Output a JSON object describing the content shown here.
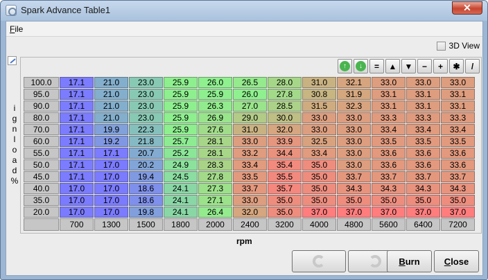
{
  "window": {
    "title": "Spark Advance Table1"
  },
  "menu": {
    "file_rest": "ile",
    "file_mnemonic": "F"
  },
  "view3d": {
    "label": "3D View",
    "checked": false
  },
  "toolbar": {
    "icons": [
      "up-circle-icon",
      "down-circle-icon",
      "equals-icon",
      "increase-icon",
      "decrease-icon",
      "minus-icon",
      "plus-icon",
      "multiply-icon",
      "color-scale-icon"
    ],
    "labels": [
      "↑",
      "↓",
      "=",
      "▲",
      "▼",
      "−",
      "+",
      "✱",
      "/"
    ]
  },
  "axis": {
    "y_label": "ignload%",
    "x_label": "rpm"
  },
  "table": {
    "rows": [
      "100.0",
      "95.0",
      "90.0",
      "80.0",
      "70.0",
      "60.0",
      "55.0",
      "50.0",
      "45.0",
      "40.0",
      "35.0",
      "20.0"
    ],
    "columns": [
      "700",
      "1300",
      "1500",
      "1800",
      "2000",
      "2400",
      "3200",
      "4000",
      "4800",
      "5600",
      "6400",
      "7200"
    ],
    "values": [
      [
        "17.1",
        "21.0",
        "23.0",
        "25.9",
        "26.0",
        "26.5",
        "28.0",
        "31.0",
        "32.1",
        "33.0",
        "33.0",
        "33.0"
      ],
      [
        "17.1",
        "21.0",
        "23.0",
        "25.9",
        "25.9",
        "26.0",
        "27.8",
        "30.8",
        "31.9",
        "33.1",
        "33.1",
        "33.1"
      ],
      [
        "17.1",
        "21.0",
        "23.0",
        "25.9",
        "26.3",
        "27.0",
        "28.5",
        "31.5",
        "32.3",
        "33.1",
        "33.1",
        "33.1"
      ],
      [
        "17.1",
        "21.0",
        "23.0",
        "25.9",
        "26.9",
        "29.0",
        "30.0",
        "33.0",
        "33.0",
        "33.3",
        "33.3",
        "33.3"
      ],
      [
        "17.1",
        "19.9",
        "22.3",
        "25.9",
        "27.6",
        "31.0",
        "32.0",
        "33.0",
        "33.0",
        "33.4",
        "33.4",
        "33.4"
      ],
      [
        "17.1",
        "19.2",
        "21.8",
        "25.7",
        "28.1",
        "33.0",
        "33.9",
        "32.5",
        "33.0",
        "33.5",
        "33.5",
        "33.5"
      ],
      [
        "17.1",
        "17.1",
        "20.7",
        "25.2",
        "28.1",
        "33.2",
        "34.4",
        "33.4",
        "33.0",
        "33.6",
        "33.6",
        "33.6"
      ],
      [
        "17.1",
        "17.0",
        "20.2",
        "24.9",
        "28.3",
        "33.4",
        "35.4",
        "35.0",
        "33.0",
        "33.6",
        "33.6",
        "33.6"
      ],
      [
        "17.1",
        "17.0",
        "19.4",
        "24.5",
        "27.8",
        "33.5",
        "35.5",
        "35.0",
        "33.7",
        "33.7",
        "33.7",
        "33.7"
      ],
      [
        "17.0",
        "17.0",
        "18.6",
        "24.1",
        "27.3",
        "33.7",
        "35.7",
        "35.0",
        "34.3",
        "34.3",
        "34.3",
        "34.3"
      ],
      [
        "17.0",
        "17.0",
        "18.6",
        "24.1",
        "27.1",
        "33.0",
        "35.0",
        "35.0",
        "35.0",
        "35.0",
        "35.0",
        "35.0"
      ],
      [
        "17.0",
        "17.0",
        "19.8",
        "24.1",
        "26.4",
        "32.0",
        "35.0",
        "37.0",
        "37.0",
        "37.0",
        "37.0",
        "37.0"
      ]
    ]
  },
  "buttons": {
    "burn_mnemonic": "B",
    "burn_rest": "urn",
    "close_mnemonic": "C",
    "close_rest": "lose"
  },
  "colors": {
    "low": "#7b7bff",
    "mid": "#8ef08e",
    "mid_high": "#d5a67f",
    "high": "#ff7d7d"
  }
}
